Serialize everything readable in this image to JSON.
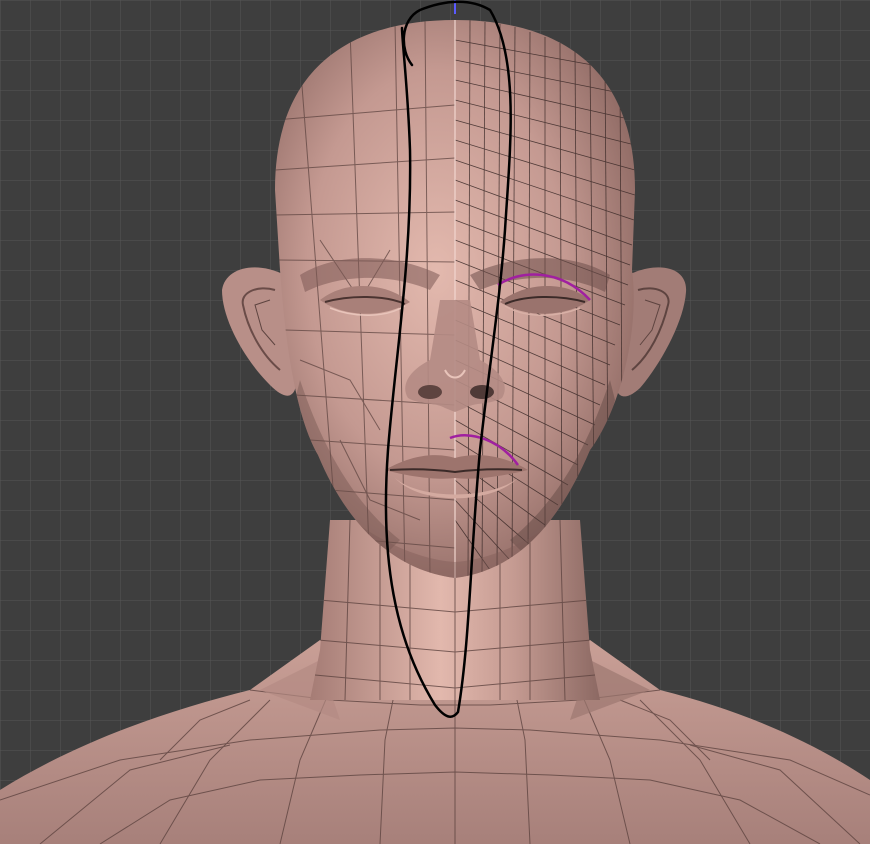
{
  "viewport": {
    "background_color": "#3e3e3e",
    "grid_color": "#5a5a5a",
    "axis_color": "#5a5aff"
  },
  "mesh": {
    "skin_color": "#c79a90",
    "skin_light": "#e8bfb5",
    "skin_shadow": "#7d5a55",
    "wire_color": "#3b2a28",
    "symmetry_line": "center-vertical"
  },
  "strokes": {
    "guide_stroke_color": "#000000",
    "highlight_stroke_color": "#a020a0"
  }
}
